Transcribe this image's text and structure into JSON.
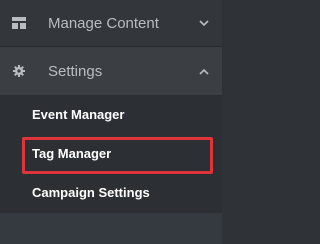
{
  "sidebar": {
    "sections": [
      {
        "label": "Manage Content",
        "icon": "content-grid-icon",
        "expanded": false,
        "chevron": "chevron-down-icon"
      },
      {
        "label": "Settings",
        "icon": "gear-icon",
        "expanded": true,
        "chevron": "chevron-up-icon"
      }
    ],
    "settings_items": [
      {
        "label": "Event Manager"
      },
      {
        "label": "Tag Manager",
        "highlighted": true
      },
      {
        "label": "Campaign Settings"
      }
    ]
  },
  "colors": {
    "background": "#2f3338",
    "active_section": "#3b3f44",
    "text_muted": "#b9bdc2",
    "text_active": "#ffffff",
    "highlight": "#e0343b"
  }
}
